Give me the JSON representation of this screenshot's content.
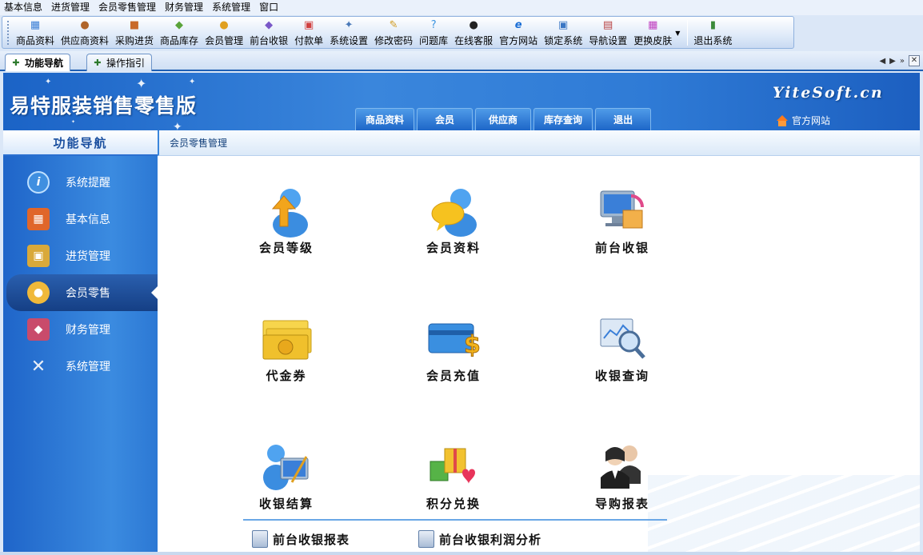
{
  "menubar": [
    "基本信息",
    "进货管理",
    "会员零售管理",
    "财务管理",
    "系统管理",
    "窗口"
  ],
  "toolbar": [
    {
      "label": "商品资料",
      "icon": "product-icon"
    },
    {
      "label": "供应商资料",
      "icon": "supplier-icon"
    },
    {
      "label": "采购进货",
      "icon": "truck-icon"
    },
    {
      "label": "商品库存",
      "icon": "inventory-icon"
    },
    {
      "label": "会员管理",
      "icon": "member-icon"
    },
    {
      "label": "前台收银",
      "icon": "cashier-icon"
    },
    {
      "label": "付款单",
      "icon": "payment-icon"
    },
    {
      "label": "系统设置",
      "icon": "settings-icon"
    },
    {
      "label": "修改密码",
      "icon": "password-icon"
    },
    {
      "label": "问题库",
      "icon": "faq-icon"
    },
    {
      "label": "在线客服",
      "icon": "qq-icon"
    },
    {
      "label": "官方网站",
      "icon": "ie-icon"
    },
    {
      "label": "锁定系统",
      "icon": "lock-icon"
    },
    {
      "label": "导航设置",
      "icon": "nav-settings-icon"
    },
    {
      "label": "更换皮肤",
      "icon": "skin-icon"
    }
  ],
  "exit_label": "退出系统",
  "tabs": [
    {
      "label": "功能导航",
      "active": true
    },
    {
      "label": "操作指引",
      "active": false
    }
  ],
  "banner": {
    "logo": "易特服装销售零售版",
    "brand": "YiteSoft.cn",
    "site_link": "官方网站",
    "nav": [
      "商品资料",
      "会员",
      "供应商",
      "库存查询",
      "退出"
    ]
  },
  "sidebar": {
    "title": "功能导航",
    "items": [
      {
        "label": "系统提醒",
        "icon": "info-icon",
        "color": "#3f8fe0"
      },
      {
        "label": "基本信息",
        "icon": "cubes-icon",
        "color": "#e0662a"
      },
      {
        "label": "进货管理",
        "icon": "box-icon",
        "color": "#d9a93a"
      },
      {
        "label": "会员零售",
        "icon": "chat-user-icon",
        "color": "#f0b93a"
      },
      {
        "label": "财务管理",
        "icon": "finance-icon",
        "color": "#c94b6b"
      },
      {
        "label": "系统管理",
        "icon": "tools-icon",
        "color": "#8aa6c8"
      }
    ],
    "active_index": 3
  },
  "content": {
    "breadcrumb": "会员零售管理",
    "functions": [
      {
        "label": "会员等级",
        "icon": "member-level-icon"
      },
      {
        "label": "会员资料",
        "icon": "member-profile-icon"
      },
      {
        "label": "前台收银",
        "icon": "front-cashier-icon"
      },
      {
        "label": "代金券",
        "icon": "voucher-icon"
      },
      {
        "label": "会员充值",
        "icon": "recharge-icon"
      },
      {
        "label": "收银查询",
        "icon": "cashier-query-icon"
      },
      {
        "label": "收银结算",
        "icon": "settlement-icon"
      },
      {
        "label": "积分兑换",
        "icon": "points-exchange-icon"
      },
      {
        "label": "导购报表",
        "icon": "guide-report-icon"
      }
    ],
    "reports": [
      "前台收银报表",
      "前台收银利润分析"
    ]
  }
}
